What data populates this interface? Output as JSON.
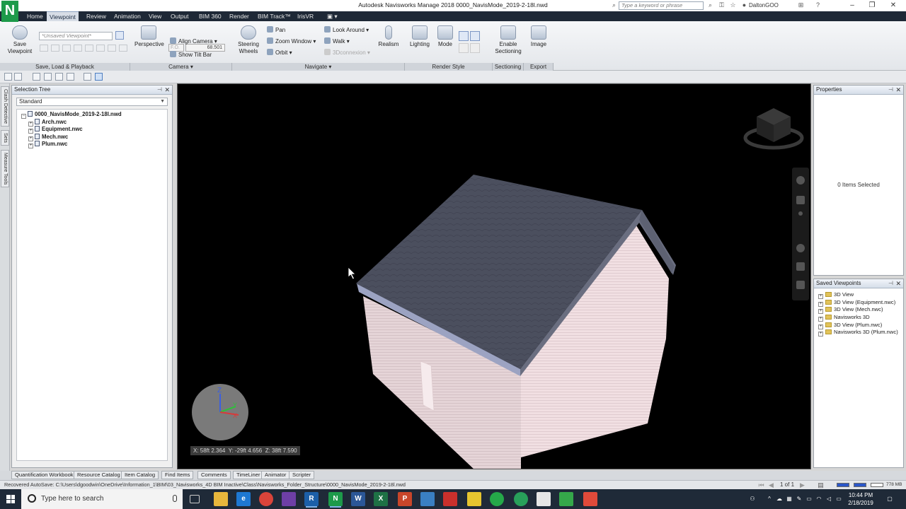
{
  "app": {
    "title": "Autodesk Navisworks Manage 2018    0000_NavisMode_2019-2-18l.nwd",
    "logo_letter": "N",
    "search_placeholder": "Type a keyword or phrase",
    "user": "DaltonGOO"
  },
  "menu": {
    "tabs": [
      "Home",
      "Viewpoint",
      "Review",
      "Animation",
      "View",
      "Output",
      "BIM 360",
      "Render",
      "BIM Track™",
      "IrisVR"
    ],
    "active": "Viewpoint"
  },
  "ribbon": {
    "save_viewpoint": "Save\nViewpoint",
    "viewpoint_combo": "*Unsaved Viewpoint*",
    "perspective": "Perspective",
    "fov_label": "F.O.",
    "fov_value": "68.501",
    "align_camera": "Align Camera",
    "show_tilt_bar": "Show Tilt Bar",
    "steering_wheels": "Steering\nWheels",
    "pan": "Pan",
    "zoom_window": "Zoom Window",
    "orbit": "Orbit",
    "look_around": "Look Around",
    "walk": "Walk",
    "connexion": "3Dconnexion",
    "realism": "Realism",
    "lighting": "Lighting",
    "mode": "Mode",
    "enable_sectioning": "Enable\nSectioning",
    "image": "Image",
    "panels": {
      "save_load": "Save, Load & Playback",
      "camera": "Camera",
      "navigate": "Navigate",
      "render_style": "Render Style",
      "sectioning": "Sectioning",
      "export": "Export"
    }
  },
  "left_tabs": [
    "Clash Detective",
    "Sets",
    "Measure Tools"
  ],
  "selection_tree": {
    "title": "Selection Tree",
    "combo": "Standard",
    "root": "0000_NavisMode_2019-2-18l.nwd",
    "items": [
      "Arch.nwc",
      "Equipment.nwc",
      "Mech.nwc",
      "Plum.nwc"
    ]
  },
  "viewport": {
    "coords": "X: 58ft 2.364  Y: -29ft 4.656  Z: 38ft 7.590",
    "axis_labels": {
      "z": "Z",
      "y": "Y",
      "x": "X"
    },
    "colors": {
      "roof": "#4a4d5c",
      "wall": "#f0dde0",
      "background": "#000000"
    }
  },
  "properties": {
    "title": "Properties",
    "items_selected": "0 Items Selected"
  },
  "saved_viewpoints": {
    "title": "Saved Viewpoints",
    "items": [
      "3D View",
      "3D View (Equipment.nwc)",
      "3D View (Mech.nwc)",
      "Navisworks 3D",
      "3D View (Plum.nwc)",
      "Navisworks 3D (Plum.nwc)"
    ]
  },
  "bottom_tabs": [
    "Quantification Workbook",
    "Resource Catalog",
    "Item Catalog",
    "Find Items",
    "Comments",
    "TimeLiner",
    "Animator",
    "Scripter"
  ],
  "status": {
    "text": "Recovered AutoSave: C:\\Users\\dgoodwin\\OneDrive\\Information_1\\BIM\\03_Navisworks_4D BIM Inactive\\Class\\Navisworks_Folder_Structure\\0000_NavisMode_2019-2-18l.nwd",
    "page": "1 of 1",
    "memory": "778 MB"
  },
  "taskbar": {
    "search_placeholder": "Type here to search",
    "time": "10:44 PM",
    "date": "2/18/2019"
  }
}
